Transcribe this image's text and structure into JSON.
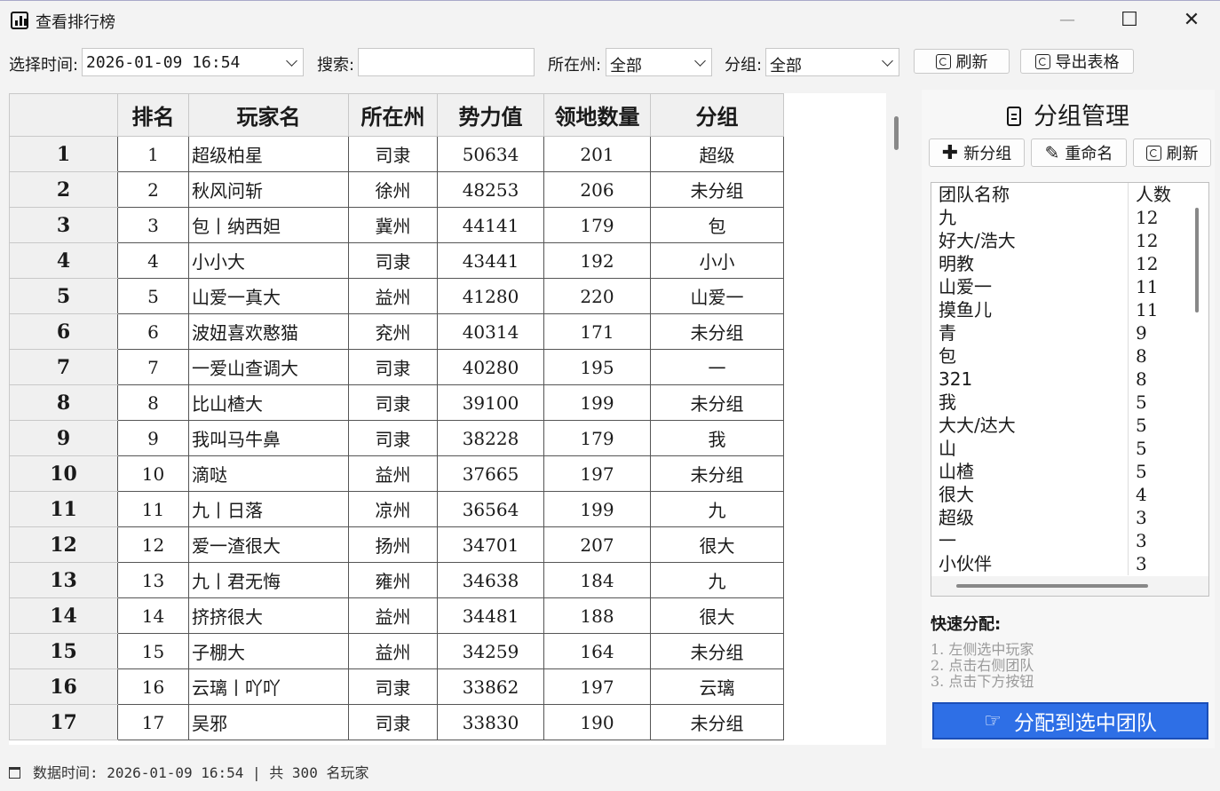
{
  "window": {
    "title": "查看排行榜",
    "minimize": "—",
    "maximize": "☐",
    "close": "✕"
  },
  "toolbar": {
    "time_label": "选择时间:",
    "time_value": "2026-01-09 16:54",
    "search_label": "搜索:",
    "search_value": "",
    "state_label": "所在州:",
    "state_value": "全部",
    "group_label": "分组:",
    "group_value": "全部",
    "refresh_label": "刷新",
    "export_label": "导出表格"
  },
  "table": {
    "columns": [
      "排名",
      "玩家名",
      "所在州",
      "势力值",
      "领地数量",
      "分组"
    ],
    "rows": [
      {
        "idx": "1",
        "rank": "1",
        "name": "超级柏星",
        "state": "司隶",
        "power": "50634",
        "land": "201",
        "group": "超级"
      },
      {
        "idx": "2",
        "rank": "2",
        "name": "秋风问斩",
        "state": "徐州",
        "power": "48253",
        "land": "206",
        "group": "未分组"
      },
      {
        "idx": "3",
        "rank": "3",
        "name": "包丨纳西妲",
        "state": "冀州",
        "power": "44141",
        "land": "179",
        "group": "包"
      },
      {
        "idx": "4",
        "rank": "4",
        "name": "小小大",
        "state": "司隶",
        "power": "43441",
        "land": "192",
        "group": "小小"
      },
      {
        "idx": "5",
        "rank": "5",
        "name": "山爱一真大",
        "state": "益州",
        "power": "41280",
        "land": "220",
        "group": "山爱一"
      },
      {
        "idx": "6",
        "rank": "6",
        "name": "波妞喜欢憨猫",
        "state": "兖州",
        "power": "40314",
        "land": "171",
        "group": "未分组"
      },
      {
        "idx": "7",
        "rank": "7",
        "name": "一爱山查调大",
        "state": "司隶",
        "power": "40280",
        "land": "195",
        "group": "一"
      },
      {
        "idx": "8",
        "rank": "8",
        "name": "比山楂大",
        "state": "司隶",
        "power": "39100",
        "land": "199",
        "group": "未分组"
      },
      {
        "idx": "9",
        "rank": "9",
        "name": "我叫马牛鼻",
        "state": "司隶",
        "power": "38228",
        "land": "179",
        "group": "我"
      },
      {
        "idx": "10",
        "rank": "10",
        "name": "滴哒",
        "state": "益州",
        "power": "37665",
        "land": "197",
        "group": "未分组"
      },
      {
        "idx": "11",
        "rank": "11",
        "name": "九丨日落",
        "state": "凉州",
        "power": "36564",
        "land": "199",
        "group": "九"
      },
      {
        "idx": "12",
        "rank": "12",
        "name": "爱一渣很大",
        "state": "扬州",
        "power": "34701",
        "land": "207",
        "group": "很大"
      },
      {
        "idx": "13",
        "rank": "13",
        "name": "九丨君无悔",
        "state": "雍州",
        "power": "34638",
        "land": "184",
        "group": "九"
      },
      {
        "idx": "14",
        "rank": "14",
        "name": "挤挤很大",
        "state": "益州",
        "power": "34481",
        "land": "188",
        "group": "很大"
      },
      {
        "idx": "15",
        "rank": "15",
        "name": "子棚大",
        "state": "益州",
        "power": "34259",
        "land": "164",
        "group": "未分组"
      },
      {
        "idx": "16",
        "rank": "16",
        "name": "云璃丨吖吖",
        "state": "司隶",
        "power": "33862",
        "land": "197",
        "group": "云璃"
      },
      {
        "idx": "17",
        "rank": "17",
        "name": "吴邪",
        "state": "司隶",
        "power": "33830",
        "land": "190",
        "group": "未分组"
      }
    ]
  },
  "panel": {
    "title": "分组管理",
    "new_group": "新分组",
    "rename": "重命名",
    "refresh": "刷新",
    "list_headers": [
      "团队名称",
      "人数"
    ],
    "groups": [
      {
        "name": "九",
        "count": "12"
      },
      {
        "name": "好大/浩大",
        "count": "12"
      },
      {
        "name": "明教",
        "count": "12"
      },
      {
        "name": "山爱一",
        "count": "11"
      },
      {
        "name": "摸鱼儿",
        "count": "11"
      },
      {
        "name": "青",
        "count": "9"
      },
      {
        "name": "包",
        "count": "8"
      },
      {
        "name": "321",
        "count": "8"
      },
      {
        "name": "我",
        "count": "5"
      },
      {
        "name": "大大/达大",
        "count": "5"
      },
      {
        "name": "山",
        "count": "5"
      },
      {
        "name": "山楂",
        "count": "5"
      },
      {
        "name": "很大",
        "count": "4"
      },
      {
        "name": "超级",
        "count": "3"
      },
      {
        "name": "一",
        "count": "3"
      },
      {
        "name": "小伙伴",
        "count": "3"
      }
    ],
    "quick_title": "快速分配:",
    "steps": [
      "1.  左侧选中玩家",
      "2.  点击右侧团队",
      "3.  点击下方按钮"
    ],
    "assign_label": "分配到选中团队"
  },
  "status": {
    "text": "数据时间: 2026-01-09 16:54 | 共 300 名玩家"
  }
}
